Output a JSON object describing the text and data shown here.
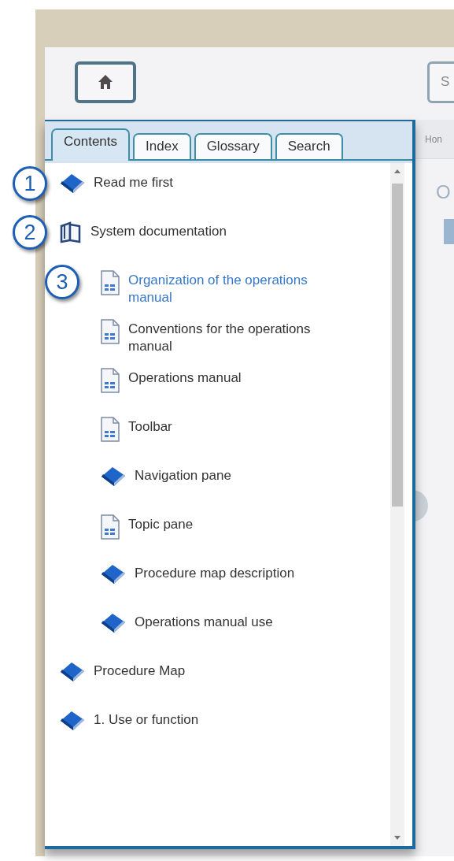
{
  "toolbar": {
    "search": {
      "placeholder": "S"
    }
  },
  "tabs": [
    {
      "label": "Contents",
      "selected": true
    },
    {
      "label": "Index",
      "selected": false
    },
    {
      "label": "Glossary",
      "selected": false
    },
    {
      "label": "Search",
      "selected": false
    }
  ],
  "tree": [
    {
      "label": "Read me first",
      "kind": "book",
      "selected": false,
      "callout": "1"
    },
    {
      "label": "System documentation",
      "kind": "open-book",
      "selected": false,
      "callout": "2",
      "children": [
        {
          "label": "Organization of the operations manual",
          "kind": "page",
          "selected": true,
          "callout": "3"
        },
        {
          "label": "Conventions for the operations manual",
          "kind": "page",
          "selected": false
        },
        {
          "label": "Operations manual",
          "kind": "page",
          "selected": false
        },
        {
          "label": "Toolbar",
          "kind": "page",
          "selected": false
        },
        {
          "label": "Navigation pane",
          "kind": "book",
          "selected": false
        },
        {
          "label": "Topic pane",
          "kind": "page",
          "selected": false
        },
        {
          "label": "Procedure map description",
          "kind": "book",
          "selected": false
        },
        {
          "label": "Operations manual use",
          "kind": "book",
          "selected": false
        }
      ]
    },
    {
      "label": "Procedure Map",
      "kind": "book",
      "selected": false
    },
    {
      "label": "1. Use or function",
      "kind": "book",
      "selected": false
    }
  ],
  "content": {
    "breadcrumb": "Hon",
    "heading": "O"
  }
}
